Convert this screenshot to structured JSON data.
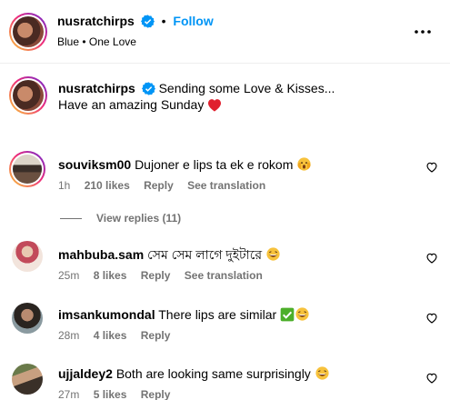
{
  "header": {
    "username": "nusratchirps",
    "dot": "•",
    "follow_label": "Follow",
    "subtitle": "Blue • One Love",
    "more_icon": "more-horizontal-icon"
  },
  "caption": {
    "username": "nusratchirps",
    "line1": "Sending some Love & Kisses...",
    "line2": "Have an amazing Sunday"
  },
  "comments": [
    {
      "username": "souviksm00",
      "text": "Dujoner e lips ta ek e rokom",
      "time": "1h",
      "likes": "210 likes",
      "reply": "Reply",
      "translation": "See translation",
      "view_replies": "View replies (11)"
    },
    {
      "username": "mahbuba.sam",
      "text": "সেম সেম লাগে দুইটারে",
      "time": "25m",
      "likes": "8 likes",
      "reply": "Reply",
      "translation": "See translation"
    },
    {
      "username": "imsankumondal",
      "text": "There lips are similar",
      "time": "28m",
      "likes": "4 likes",
      "reply": "Reply"
    },
    {
      "username": "ujjaldey2",
      "text": "Both are looking same surprisingly",
      "time": "27m",
      "likes": "5 likes",
      "reply": "Reply"
    }
  ],
  "colors": {
    "follow": "#0095f6",
    "verified": "#0095f6",
    "meta": "#737373",
    "heart_red": "#ff3040"
  }
}
